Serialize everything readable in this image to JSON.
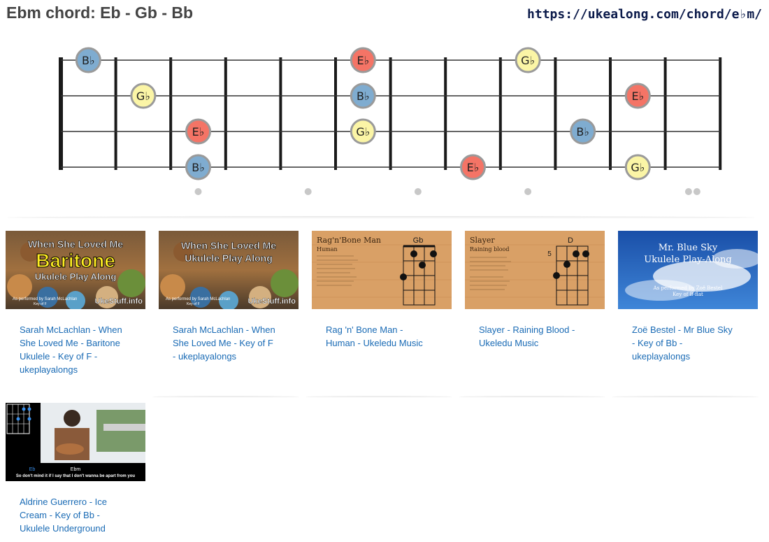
{
  "header": {
    "title": "Ebm chord: Eb - Gb - Bb",
    "url": "https://ukealong.com/chord/e♭m/"
  },
  "fretboard": {
    "string_count": 4,
    "fret_count": 12,
    "note_colors": {
      "E♭": "#f47466",
      "G♭": "#fbf5a6",
      "B♭": "#7facd0"
    },
    "notes": [
      {
        "label": "B♭",
        "string": 1,
        "fret": 0
      },
      {
        "label": "E♭",
        "string": 1,
        "fret": 5
      },
      {
        "label": "G♭",
        "string": 1,
        "fret": 8
      },
      {
        "label": "G♭",
        "string": 2,
        "fret": 1
      },
      {
        "label": "B♭",
        "string": 2,
        "fret": 5
      },
      {
        "label": "E♭",
        "string": 2,
        "fret": 10
      },
      {
        "label": "E♭",
        "string": 3,
        "fret": 2
      },
      {
        "label": "G♭",
        "string": 3,
        "fret": 5
      },
      {
        "label": "B♭",
        "string": 3,
        "fret": 9
      },
      {
        "label": "B♭",
        "string": 4,
        "fret": 2
      },
      {
        "label": "E♭",
        "string": 4,
        "fret": 7
      },
      {
        "label": "G♭",
        "string": 4,
        "fret": 10
      }
    ],
    "inlay_frets": [
      3,
      5,
      7,
      9
    ],
    "double_inlay_fret": 12
  },
  "videos": [
    {
      "title": "Sarah McLachlan - When She Loved Me - Baritone Ukulele - Key of F - ukeplayalongs",
      "thumb": {
        "line1": "When She Loved Me",
        "line2": "Baritone",
        "line3": "Ukulele Play Along",
        "credit": "As performed by Sarah McLachlan",
        "key": "Key of F",
        "brand": "UkeStuff.info"
      }
    },
    {
      "title": "Sarah McLachlan - When She Loved Me - Key of F - ukeplayalongs",
      "thumb": {
        "line1": "When She Loved Me",
        "line2": "Ukulele Play Along",
        "credit": "As performed by Sarah McLachlan",
        "key": "Key of F",
        "brand": "UkeStuff.info"
      }
    },
    {
      "title": "Rag 'n' Bone Man - Human - Ukeledu Music",
      "thumb": {
        "line1": "Rag'n'Bone Man",
        "line2": "Human",
        "chord": "Gb"
      }
    },
    {
      "title": "Slayer - Raining Blood - Ukeledu Music",
      "thumb": {
        "line1": "Slayer",
        "line2": "Raining blood",
        "chord": "D",
        "fret": "5"
      }
    },
    {
      "title": "Zoë Bestel - Mr Blue Sky - Key of Bb - ukeplayalongs",
      "thumb": {
        "line1": "Mr. Blue Sky",
        "line2": "Ukulele Play-Along",
        "credit": "As performed by Zoë Bestel",
        "key": "Key of B-flat"
      }
    },
    {
      "title": "Aldrine Guerrero - Ice Cream - Key of Bb - Ukulele Underground",
      "thumb": {
        "chord_left": "Eb",
        "chord_right": "Ebm",
        "lyric": "So don't mind it if I say that I   don't wanna be apart from you"
      }
    }
  ]
}
